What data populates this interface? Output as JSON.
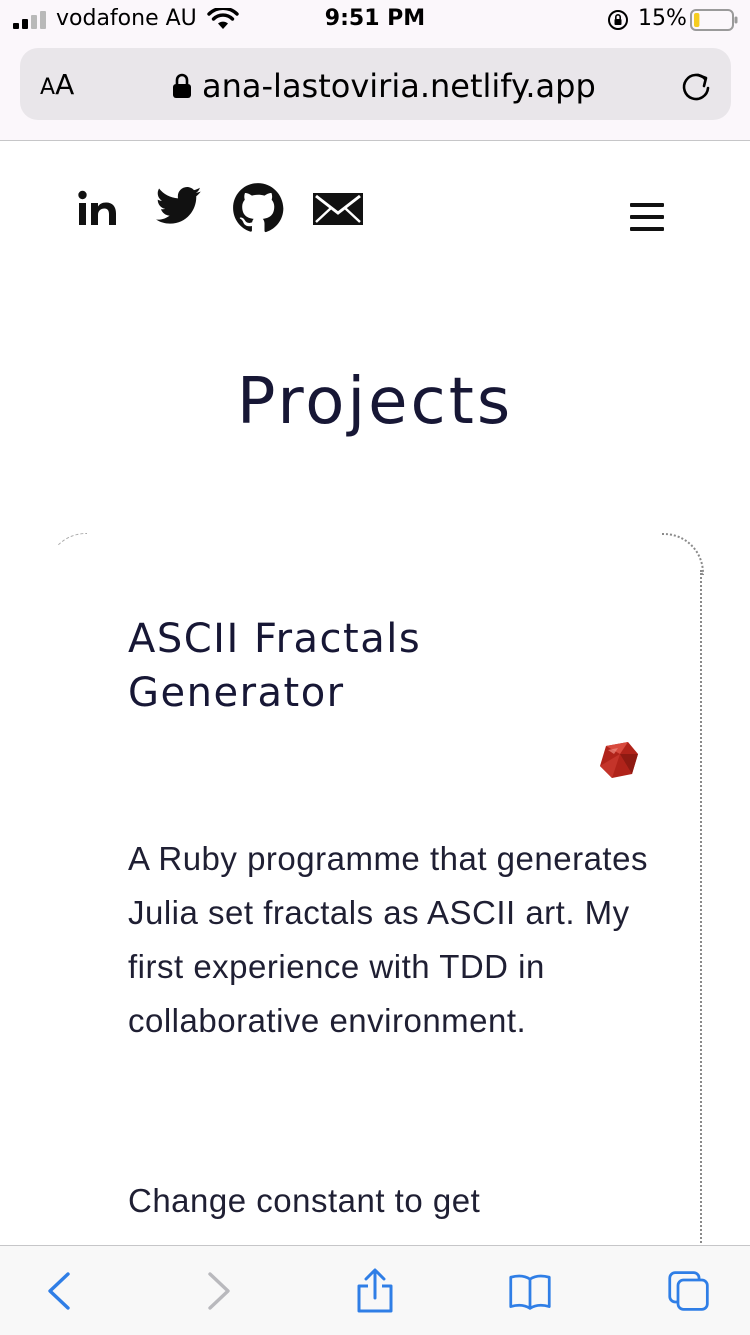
{
  "status_bar": {
    "carrier": "vodafone AU",
    "time": "9:51 PM",
    "battery_percent": "15%",
    "battery_level": 0.15
  },
  "url_bar": {
    "text_size_label_small": "A",
    "text_size_label_large": "A",
    "url": "ana-lastoviria.netlify.app"
  },
  "page": {
    "title": "Projects",
    "social_icons": [
      "linkedin-icon",
      "twitter-icon",
      "github-icon",
      "mail-icon"
    ]
  },
  "project": {
    "title": "ASCII Fractals Generator",
    "tech_icon": "ruby-icon",
    "description": "A Ruby programme that generates Julia set fractals as ASCII art. My first experience with TDD in collaborative environment.",
    "description_2": "Change constant to get"
  },
  "toolbar": {
    "icons": [
      "back-icon",
      "forward-icon",
      "share-icon",
      "bookmarks-icon",
      "tabs-icon"
    ]
  },
  "colors": {
    "accent": "#2f7ee6",
    "heading": "#171735",
    "ruby": "#b0231a"
  }
}
